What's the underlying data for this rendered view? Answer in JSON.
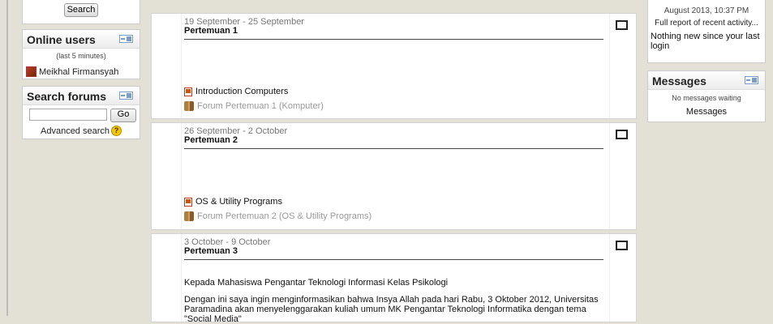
{
  "left": {
    "top_search_label": "Search",
    "online_users": {
      "title": "Online users",
      "subtitle": "(last 5 minutes)",
      "users": [
        "Meikhal Firmansyah"
      ]
    },
    "search_forums": {
      "title": "Search forums",
      "go_label": "Go",
      "advanced_label": "Advanced search"
    }
  },
  "sections": [
    {
      "date": "19 September - 25 September",
      "title": "Pertemuan 1",
      "activities": [
        {
          "icon": "presentation-icon",
          "label": "Introduction Computers"
        },
        {
          "icon": "forum-icon",
          "label": "Forum Pertemuan 1 (Komputer)"
        }
      ]
    },
    {
      "date": "26 September - 2 October",
      "title": "Pertemuan 2",
      "activities": [
        {
          "icon": "presentation-icon",
          "label": "OS & Utility Programs"
        },
        {
          "icon": "forum-icon",
          "label": "Forum Pertemuan 2 (OS & Utility Programs)"
        }
      ]
    },
    {
      "date": "3 October - 9 October",
      "title": "Pertemuan 3",
      "text1": "Kepada Mahasiswa Pengantar Teknologi Informasi Kelas Psikologi",
      "text2": "Dengan ini saya ingin menginformasikan bahwa Insya Allah pada hari Rabu, 3 Oktober 2012, Universitas Paramadina akan menyelenggarakan kuliah umum MK Pengantar Teknologi Informatika dengan tema \"Social Media\""
    }
  ],
  "right": {
    "recent": {
      "date": "August 2013, 10:37 PM",
      "full_report": "Full report of recent activity...",
      "nothing_new": "Nothing new since your last login"
    },
    "messages": {
      "title": "Messages",
      "subtitle": "No messages waiting",
      "link": "Messages"
    }
  },
  "colors": {
    "page_bg": "#e3e0d6",
    "block_bg": "#ffffff",
    "help_icon": "#f5c400"
  }
}
